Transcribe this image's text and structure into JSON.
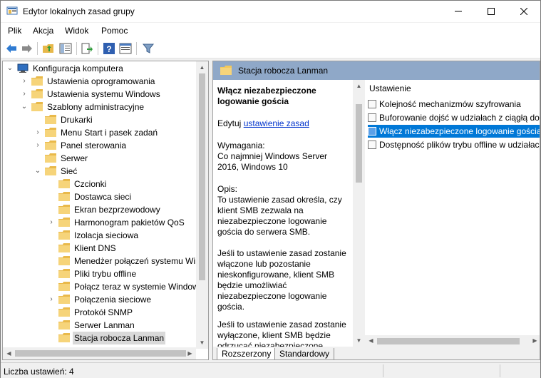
{
  "window": {
    "title": "Edytor lokalnych zasad grupy"
  },
  "titlebar": {
    "minimize": "—",
    "maximize": "☐",
    "close": "✕"
  },
  "menu": [
    "Plik",
    "Akcja",
    "Widok",
    "Pomoc"
  ],
  "tree": [
    {
      "label": "Konfiguracja komputera",
      "level": 0,
      "exp": "⌄",
      "icon": "computer-icon"
    },
    {
      "label": "Ustawienia oprogramowania",
      "level": 1,
      "exp": "›"
    },
    {
      "label": "Ustawienia systemu Windows",
      "level": 1,
      "exp": "›"
    },
    {
      "label": "Szablony administracyjne",
      "level": 1,
      "exp": "⌄"
    },
    {
      "label": "Drukarki",
      "level": 2,
      "exp": ""
    },
    {
      "label": "Menu Start i pasek zadań",
      "level": 2,
      "exp": "›"
    },
    {
      "label": "Panel sterowania",
      "level": 2,
      "exp": "›"
    },
    {
      "label": "Serwer",
      "level": 2,
      "exp": ""
    },
    {
      "label": "Sieć",
      "level": 2,
      "exp": "⌄"
    },
    {
      "label": "Czcionki",
      "level": 3,
      "exp": ""
    },
    {
      "label": "Dostawca sieci",
      "level": 3,
      "exp": ""
    },
    {
      "label": "Ekran bezprzewodowy",
      "level": 3,
      "exp": ""
    },
    {
      "label": "Harmonogram pakietów QoS",
      "level": 3,
      "exp": "›"
    },
    {
      "label": "Izolacja sieciowa",
      "level": 3,
      "exp": ""
    },
    {
      "label": "Klient DNS",
      "level": 3,
      "exp": ""
    },
    {
      "label": "Menedżer połączeń systemu Win",
      "level": 3,
      "exp": ""
    },
    {
      "label": "Pliki trybu offline",
      "level": 3,
      "exp": ""
    },
    {
      "label": "Połącz teraz w systemie Window",
      "level": 3,
      "exp": ""
    },
    {
      "label": "Połączenia sieciowe",
      "level": 3,
      "exp": "›"
    },
    {
      "label": "Protokół SNMP",
      "level": 3,
      "exp": ""
    },
    {
      "label": "Serwer Lanman",
      "level": 3,
      "exp": ""
    },
    {
      "label": "Stacja robocza Lanman",
      "level": 3,
      "exp": "",
      "selected": true
    }
  ],
  "right": {
    "header": "Stacja robocza Lanman",
    "desc_title": "Włącz niezabezpieczone logowanie gościa",
    "edit_prefix": "Edytuj ",
    "edit_link": "ustawienie zasad ",
    "requirements_label": "Wymagania:",
    "requirements": "Co najmniej Windows Server 2016, Windows 10",
    "description_label": "Opis:",
    "description": "To ustawienie zasad określa, czy klient SMB zezwala na niezabezpieczone logowanie gościa do serwera SMB.",
    "para2": "Jeśli to ustawienie zasad zostanie włączone lub pozostanie nieskonfigurowane, klient SMB będzie umożliwiać niezabezpieczone logowanie gościa.",
    "para3": "Jeśli to ustawienie zasad zostanie wyłączone, klient SMB będzie odrzucać niezabezpieczone",
    "list_header": "Ustawienie",
    "items": [
      "Kolejność mechanizmów szyfrowania",
      "Buforowanie dojść w udziałach z ciągłą dostępnością",
      "Włącz niezabezpieczone logowanie gościa",
      "Dostępność plików trybu offline w udziałach z ciągłą dostępnością"
    ],
    "selected_index": 2,
    "tabs": [
      "Rozszerzony",
      "Standardowy"
    ]
  },
  "status": {
    "text": "Liczba ustawień: 4"
  },
  "colors": {
    "selected": "#0078d7",
    "header": "#8fa8c8",
    "link": "#0033cc"
  }
}
